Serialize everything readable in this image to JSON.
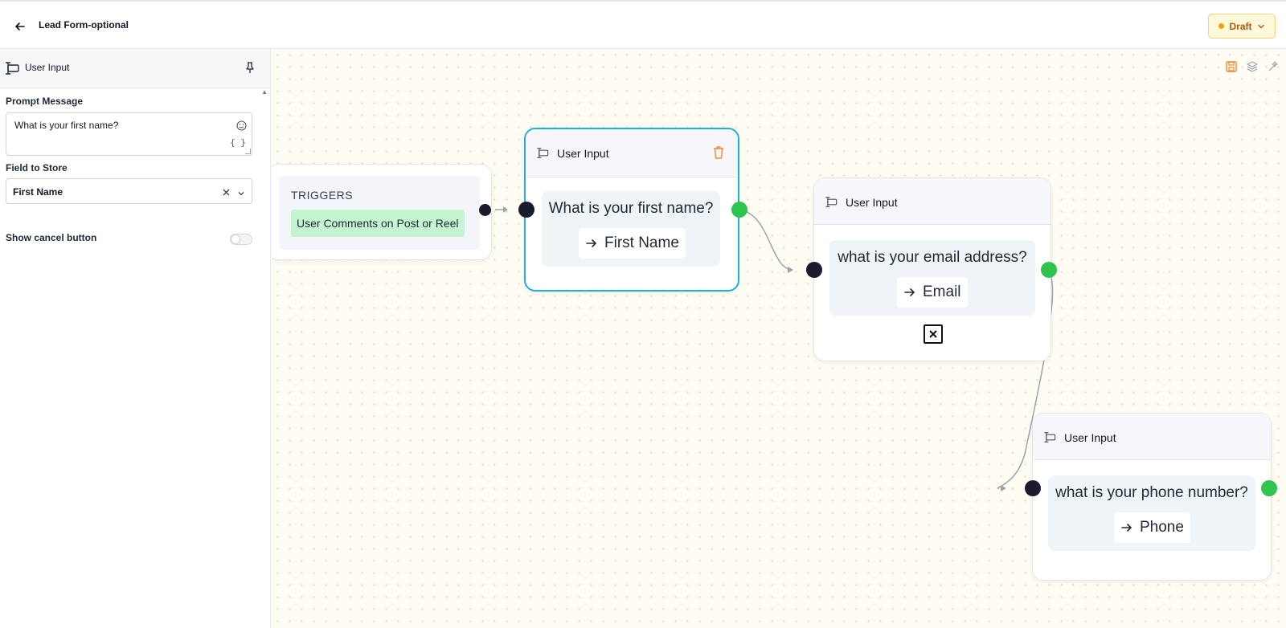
{
  "header": {
    "title": "Lead Form-optional",
    "status": "Draft"
  },
  "sidebar": {
    "panel_title": "User Input",
    "prompt_label": "Prompt Message",
    "prompt_value": "What is your first name?",
    "braces": "{ }",
    "field_label": "Field to Store",
    "field_value": "First Name",
    "cancel_label": "Show cancel button",
    "cancel_enabled": false
  },
  "canvas": {
    "trigger": {
      "title": "TRIGGERS",
      "tag": "User Comments on Post or Reel"
    },
    "nodes": [
      {
        "title": "User Input",
        "message": "What is your first name?",
        "field": "First Name",
        "selected": true
      },
      {
        "title": "User Input",
        "message": "what is your email address?",
        "field": "Email",
        "cancel_button": true
      },
      {
        "title": "User Input",
        "message": "what is your phone number?",
        "field": "Phone"
      }
    ]
  },
  "colors": {
    "selected_border": "#1fb0d8",
    "output_handle": "#2fc44f",
    "input_handle": "#1b1b2e",
    "draft_accent": "#b45309",
    "canvas_bg": "#fffcf3"
  }
}
